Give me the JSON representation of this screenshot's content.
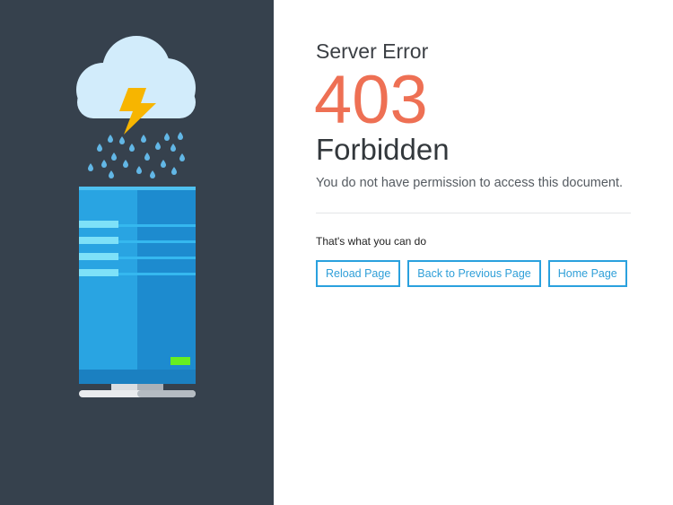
{
  "error": {
    "subtitle": "Server Error",
    "code": "403",
    "title": "Forbidden",
    "message": "You do not have permission to access this document."
  },
  "options": {
    "label": "That's what you can do",
    "buttons": [
      {
        "label": "Reload Page"
      },
      {
        "label": "Back to Previous Page"
      },
      {
        "label": "Home Page"
      }
    ]
  },
  "illustration": {
    "icons": [
      "storm-cloud-icon",
      "lightning-bolt-icon",
      "raindrops-icon",
      "server-icon",
      "status-led-icon"
    ]
  },
  "colors": {
    "sidebar": "#36414d",
    "accent": "#2aa1de",
    "error_code": "#ee7054",
    "led": "#66ee22",
    "bolt": "#f7b500"
  }
}
